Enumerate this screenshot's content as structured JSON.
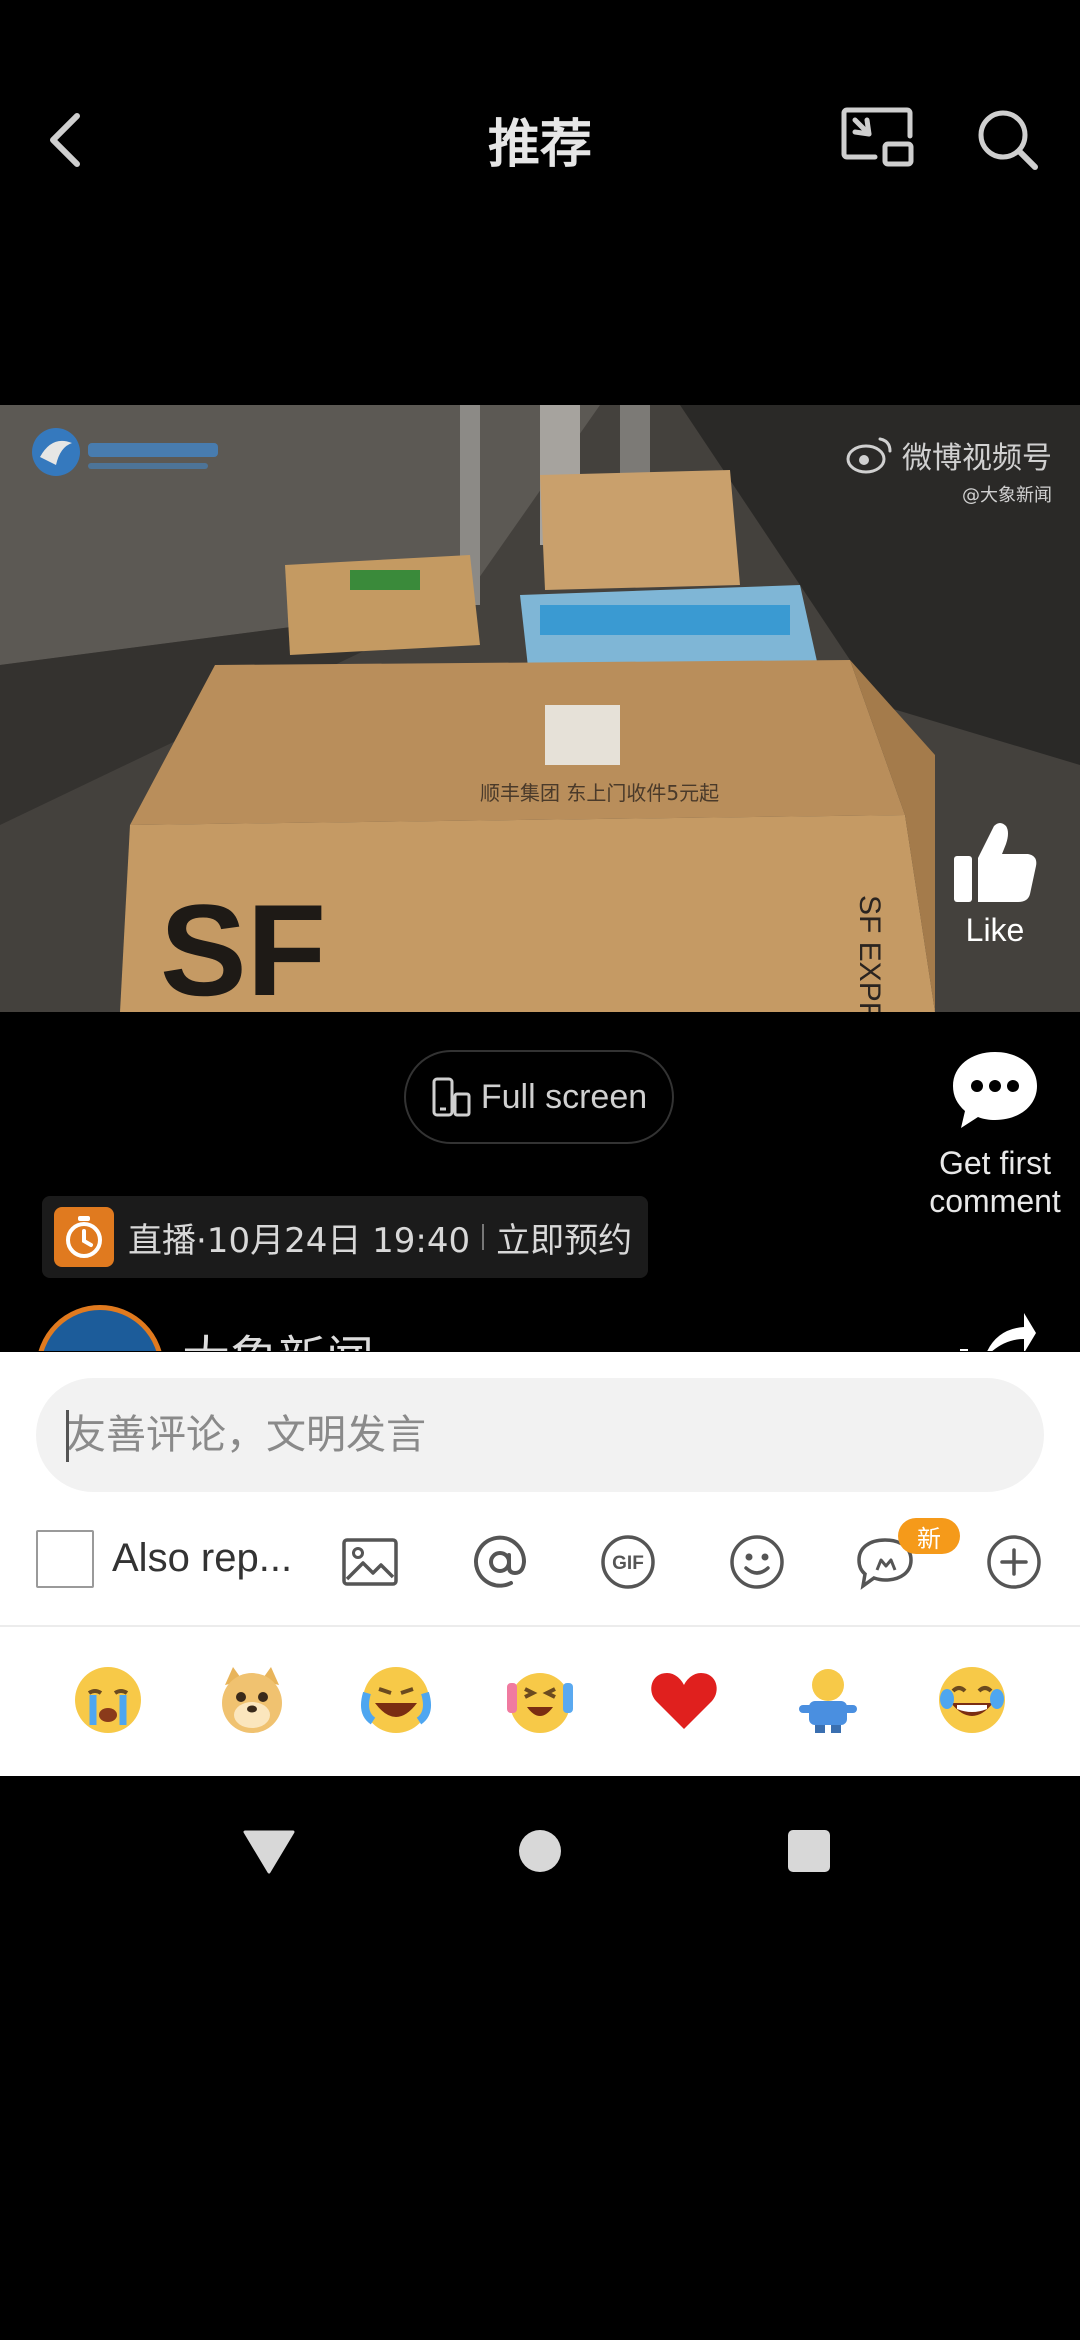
{
  "header": {
    "title": "推荐"
  },
  "video": {
    "watermark_platform": "微博视频号",
    "watermark_source": "@大象新闻",
    "box_brand": "SF",
    "box_side_text": "SF EXPRES",
    "box_label": "顺丰集团 东上门收件5元起"
  },
  "actions": {
    "like_label": "Like",
    "comment_label": "Get first comment"
  },
  "fullscreen": {
    "label": "Full screen"
  },
  "live": {
    "text": "直播·10月24日 19:40",
    "cta": "立即预约"
  },
  "account": {
    "name": "大象新闻"
  },
  "composer": {
    "placeholder": "友善评论，文明发言",
    "repost_label": "Also rep...",
    "new_badge": "新"
  },
  "emojis": [
    "crying-face-emoji",
    "doge-emoji",
    "laughing-crying-emoji",
    "excited-emoji",
    "heart-emoji",
    "doll-emoji",
    "tears-of-joy-emoji"
  ],
  "colors": {
    "accent": "#e07a1f",
    "badge": "#f59a1a",
    "heart": "#e0201e"
  }
}
